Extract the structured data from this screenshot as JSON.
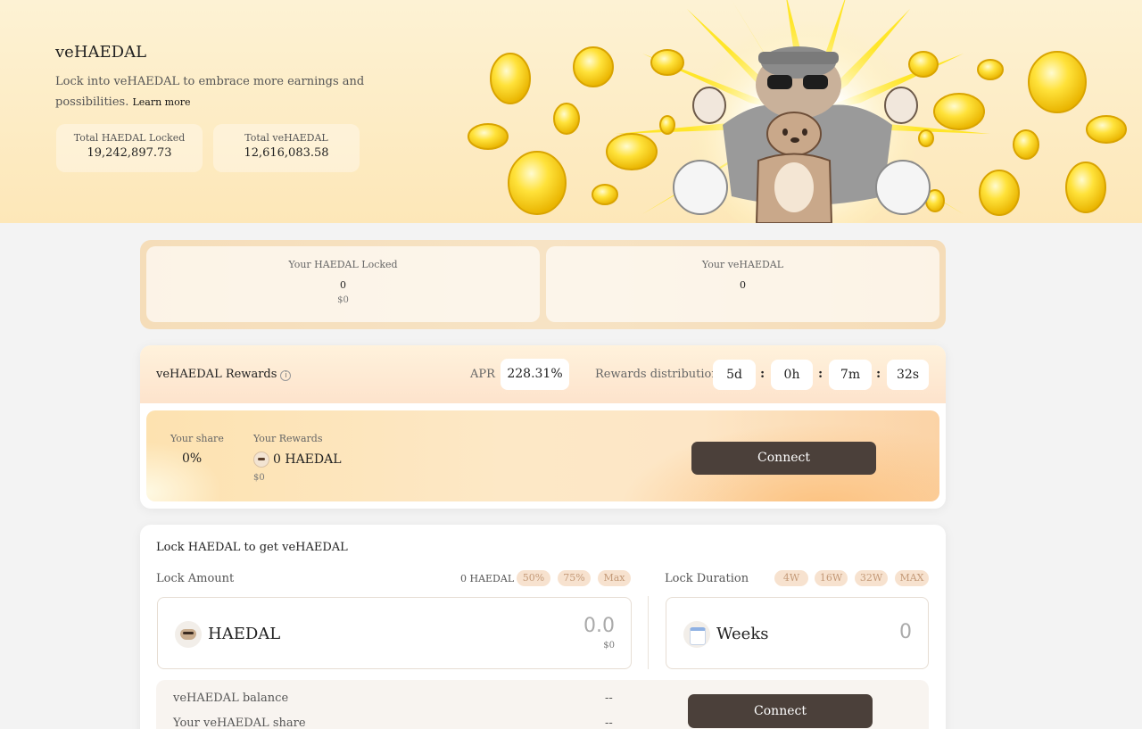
{
  "hero": {
    "title": "veHAEDAL",
    "subtitle": "Lock into veHAEDAL to embrace more earnings and possibilities.",
    "learn_more": "Learn more",
    "stats": [
      {
        "label": "Total HAEDAL Locked",
        "value": "19,242,897.73"
      },
      {
        "label": "Total veHAEDAL",
        "value": "12,616,083.58"
      }
    ]
  },
  "locked": {
    "haedal": {
      "label": "Your HAEDAL Locked",
      "value": "0",
      "usd": "$0"
    },
    "vehaedal": {
      "label": "Your veHAEDAL",
      "value": "0"
    }
  },
  "rewards": {
    "title": "veHAEDAL Rewards",
    "info_icon": "i",
    "apr_label": "APR",
    "apr_value": "228.31%",
    "distribution_label": "Rewards distribution in",
    "countdown": {
      "days": "5d",
      "hours": "0h",
      "minutes": "7m",
      "seconds": "32s"
    },
    "separator": ":",
    "share_label": "Your share",
    "share_value": "0%",
    "rewards_label": "Your Rewards",
    "rewards_value": "0 HAEDAL",
    "rewards_usd": "$0",
    "connect_label": "Connect"
  },
  "lock": {
    "title": "Lock HAEDAL to get veHAEDAL",
    "amount_label": "Lock Amount",
    "balance": "0 HAEDAL",
    "amount_chips": [
      "50%",
      "75%",
      "Max"
    ],
    "duration_label": "Lock Duration",
    "duration_chips": [
      "4W",
      "16W",
      "32W",
      "MAX"
    ],
    "token_name": "HAEDAL",
    "amount_placeholder": "0.0",
    "amount_usd": "$0",
    "weeks_label": "Weeks",
    "weeks_value": "0",
    "summary": [
      {
        "label": "veHAEDAL balance",
        "value": "--"
      },
      {
        "label": "Your veHAEDAL share",
        "value": "--"
      }
    ],
    "connect_label": "Connect"
  },
  "colors": {
    "accent_dark": "#4b403a",
    "hero_bg": "#fdeec8",
    "chip_bg": "#f7e2cf"
  }
}
